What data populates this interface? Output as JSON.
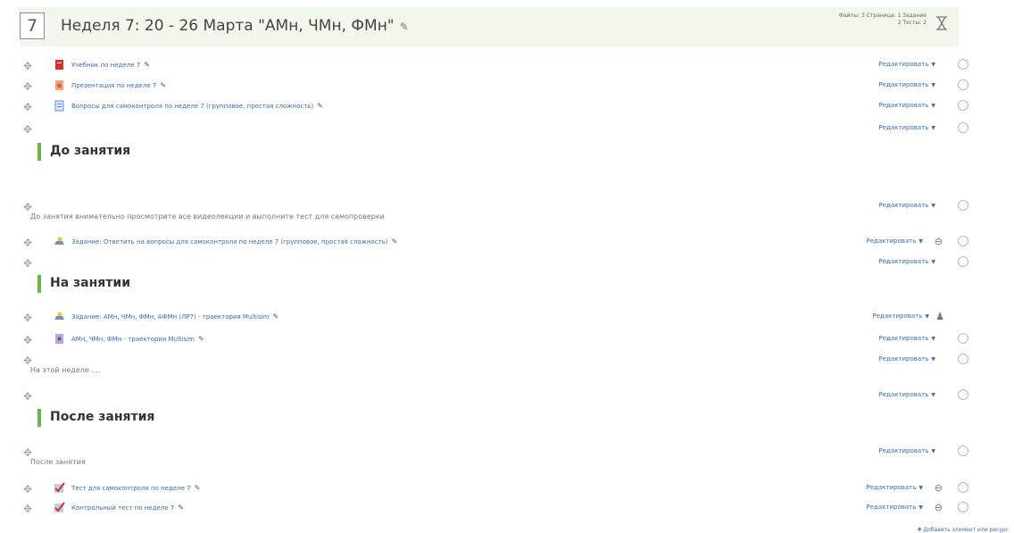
{
  "header": {
    "week_number": "7",
    "title": "Неделя 7: 20 - 26 Марта \"АМн, ЧМн, ФМн\"",
    "summary_line1": "Файлы: 3 Страница: 1 Задание",
    "summary_line2": "2 Тесты: 2"
  },
  "edit_label": "Редактировать",
  "items_top": [
    {
      "label": "Учебник по неделе 7",
      "icon": "pdf-icon"
    },
    {
      "label": "Презентация по неделе 7",
      "icon": "presentation-icon"
    },
    {
      "label": "Вопросы для самоконтроля по неделе 7 (групповое, простая сложность)",
      "icon": "document-icon"
    }
  ],
  "sections": {
    "before": {
      "title": "До занятия",
      "text": "До занятия внимательно просмотрите все видеолекции и выполните тест для самопроверки",
      "assignment": "Задание: Ответить на вопросы для самоконтроля по неделе 7 (групповое, простая сложность)"
    },
    "during": {
      "title": "На занятии",
      "assignment": "Задание: АМн, ЧМн, ФМн, АФМн (ЛР7) - траектория Multisim",
      "file": "АМн, ЧМн, ФМн - траектория Multisim",
      "text": "На этой неделе ...."
    },
    "after": {
      "title": "После занятия",
      "text": "После занятия",
      "quiz1": "Тест для самоконтроля по неделе 7",
      "quiz2": "Контрольный тест по неделе 7"
    }
  },
  "footer": {
    "add_label": "Добавить элемент или ресурс"
  },
  "colors": {
    "accent_green": "#6cb34b",
    "link_blue": "#3d6db0",
    "header_bg": "#f1f7ec"
  }
}
